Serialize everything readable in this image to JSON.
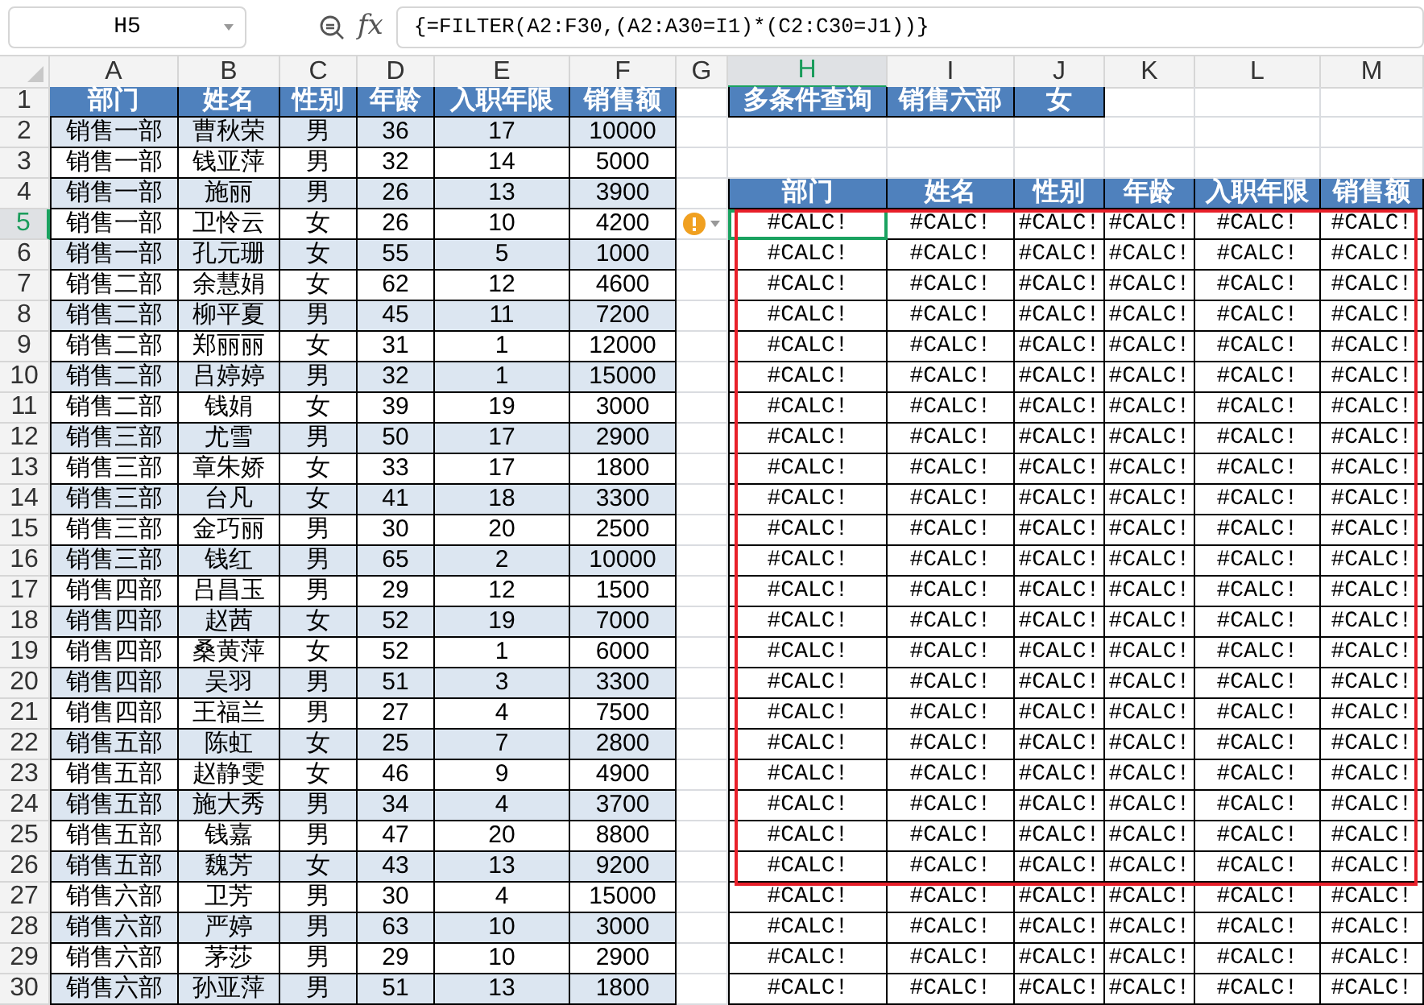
{
  "name_box": {
    "value": "H5"
  },
  "formula_bar": {
    "fx": "fx",
    "formula": "{=FILTER(A2:F30,(A2:A30=I1)*(C2:C30=J1))}"
  },
  "column_headers": [
    {
      "label": "A",
      "selected": false
    },
    {
      "label": "B",
      "selected": false
    },
    {
      "label": "C",
      "selected": false
    },
    {
      "label": "D",
      "selected": false
    },
    {
      "label": "E",
      "selected": false
    },
    {
      "label": "F",
      "selected": false
    },
    {
      "label": "G",
      "selected": false
    },
    {
      "label": "H",
      "selected": true
    },
    {
      "label": "I",
      "selected": false
    },
    {
      "label": "J",
      "selected": false
    },
    {
      "label": "K",
      "selected": false
    },
    {
      "label": "L",
      "selected": false
    },
    {
      "label": "M",
      "selected": false
    }
  ],
  "row_numbers": [
    {
      "label": "1",
      "selected": false
    },
    {
      "label": "2",
      "selected": false
    },
    {
      "label": "3",
      "selected": false
    },
    {
      "label": "4",
      "selected": false
    },
    {
      "label": "5",
      "selected": true
    },
    {
      "label": "6",
      "selected": false
    },
    {
      "label": "7",
      "selected": false
    },
    {
      "label": "8",
      "selected": false
    },
    {
      "label": "9",
      "selected": false
    },
    {
      "label": "10",
      "selected": false
    },
    {
      "label": "11",
      "selected": false
    },
    {
      "label": "12",
      "selected": false
    },
    {
      "label": "13",
      "selected": false
    },
    {
      "label": "14",
      "selected": false
    },
    {
      "label": "15",
      "selected": false
    },
    {
      "label": "16",
      "selected": false
    },
    {
      "label": "17",
      "selected": false
    },
    {
      "label": "18",
      "selected": false
    },
    {
      "label": "19",
      "selected": false
    },
    {
      "label": "20",
      "selected": false
    },
    {
      "label": "21",
      "selected": false
    },
    {
      "label": "22",
      "selected": false
    },
    {
      "label": "23",
      "selected": false
    },
    {
      "label": "24",
      "selected": false
    },
    {
      "label": "25",
      "selected": false
    },
    {
      "label": "26",
      "selected": false
    },
    {
      "label": "27",
      "selected": false
    },
    {
      "label": "28",
      "selected": false
    },
    {
      "label": "29",
      "selected": false
    },
    {
      "label": "30",
      "selected": false
    }
  ],
  "data_table": {
    "columns": [
      "部门",
      "姓名",
      "性别",
      "年龄",
      "入职年限",
      "销售额"
    ],
    "rows": [
      [
        "销售一部",
        "曹秋荣",
        "男",
        "36",
        "17",
        "10000"
      ],
      [
        "销售一部",
        "钱亚萍",
        "男",
        "32",
        "14",
        "5000"
      ],
      [
        "销售一部",
        "施丽",
        "男",
        "26",
        "13",
        "3900"
      ],
      [
        "销售一部",
        "卫怜云",
        "女",
        "26",
        "10",
        "4200"
      ],
      [
        "销售一部",
        "孔元珊",
        "女",
        "55",
        "5",
        "1000"
      ],
      [
        "销售二部",
        "余慧娟",
        "女",
        "62",
        "12",
        "4600"
      ],
      [
        "销售二部",
        "柳平夏",
        "男",
        "45",
        "11",
        "7200"
      ],
      [
        "销售二部",
        "郑丽丽",
        "女",
        "31",
        "1",
        "12000"
      ],
      [
        "销售二部",
        "吕婷婷",
        "男",
        "32",
        "1",
        "15000"
      ],
      [
        "销售二部",
        "钱娟",
        "女",
        "39",
        "19",
        "3000"
      ],
      [
        "销售三部",
        "尤雪",
        "男",
        "50",
        "17",
        "2900"
      ],
      [
        "销售三部",
        "章朱娇",
        "女",
        "33",
        "17",
        "1800"
      ],
      [
        "销售三部",
        "台凡",
        "女",
        "41",
        "18",
        "3300"
      ],
      [
        "销售三部",
        "金巧丽",
        "男",
        "30",
        "20",
        "2500"
      ],
      [
        "销售三部",
        "钱红",
        "男",
        "65",
        "2",
        "10000"
      ],
      [
        "销售四部",
        "吕昌玉",
        "男",
        "29",
        "12",
        "1500"
      ],
      [
        "销售四部",
        "赵茜",
        "女",
        "52",
        "19",
        "7000"
      ],
      [
        "销售四部",
        "桑黄萍",
        "女",
        "52",
        "1",
        "6000"
      ],
      [
        "销售四部",
        "吴羽",
        "男",
        "51",
        "3",
        "3300"
      ],
      [
        "销售四部",
        "王福兰",
        "男",
        "27",
        "4",
        "7500"
      ],
      [
        "销售五部",
        "陈虹",
        "女",
        "25",
        "7",
        "2800"
      ],
      [
        "销售五部",
        "赵静雯",
        "女",
        "46",
        "9",
        "4900"
      ],
      [
        "销售五部",
        "施大秀",
        "男",
        "34",
        "4",
        "3700"
      ],
      [
        "销售五部",
        "钱嘉",
        "男",
        "47",
        "20",
        "8800"
      ],
      [
        "销售五部",
        "魏芳",
        "女",
        "43",
        "13",
        "9200"
      ],
      [
        "销售六部",
        "卫芳",
        "男",
        "30",
        "4",
        "15000"
      ],
      [
        "销售六部",
        "严婷",
        "男",
        "63",
        "10",
        "3000"
      ],
      [
        "销售六部",
        "茅莎",
        "男",
        "29",
        "10",
        "2900"
      ],
      [
        "销售六部",
        "孙亚萍",
        "男",
        "51",
        "13",
        "1800"
      ]
    ]
  },
  "query": [
    "多条件查询",
    "销售六部",
    "女"
  ],
  "result_table": {
    "columns": [
      "部门",
      "姓名",
      "性别",
      "年龄",
      "入职年限",
      "销售额"
    ],
    "rows": [
      {
        "selected": true,
        "warning": true,
        "cells": [
          "#CALC!",
          "#CALC!",
          "#CALC!",
          "#CALC!",
          "#CALC!",
          "#CALC!"
        ]
      },
      {
        "selected": false,
        "warning": false,
        "cells": [
          "#CALC!",
          "#CALC!",
          "#CALC!",
          "#CALC!",
          "#CALC!",
          "#CALC!"
        ]
      },
      {
        "selected": false,
        "warning": false,
        "cells": [
          "#CALC!",
          "#CALC!",
          "#CALC!",
          "#CALC!",
          "#CALC!",
          "#CALC!"
        ]
      },
      {
        "selected": false,
        "warning": false,
        "cells": [
          "#CALC!",
          "#CALC!",
          "#CALC!",
          "#CALC!",
          "#CALC!",
          "#CALC!"
        ]
      },
      {
        "selected": false,
        "warning": false,
        "cells": [
          "#CALC!",
          "#CALC!",
          "#CALC!",
          "#CALC!",
          "#CALC!",
          "#CALC!"
        ]
      },
      {
        "selected": false,
        "warning": false,
        "cells": [
          "#CALC!",
          "#CALC!",
          "#CALC!",
          "#CALC!",
          "#CALC!",
          "#CALC!"
        ]
      },
      {
        "selected": false,
        "warning": false,
        "cells": [
          "#CALC!",
          "#CALC!",
          "#CALC!",
          "#CALC!",
          "#CALC!",
          "#CALC!"
        ]
      },
      {
        "selected": false,
        "warning": false,
        "cells": [
          "#CALC!",
          "#CALC!",
          "#CALC!",
          "#CALC!",
          "#CALC!",
          "#CALC!"
        ]
      },
      {
        "selected": false,
        "warning": false,
        "cells": [
          "#CALC!",
          "#CALC!",
          "#CALC!",
          "#CALC!",
          "#CALC!",
          "#CALC!"
        ]
      },
      {
        "selected": false,
        "warning": false,
        "cells": [
          "#CALC!",
          "#CALC!",
          "#CALC!",
          "#CALC!",
          "#CALC!",
          "#CALC!"
        ]
      },
      {
        "selected": false,
        "warning": false,
        "cells": [
          "#CALC!",
          "#CALC!",
          "#CALC!",
          "#CALC!",
          "#CALC!",
          "#CALC!"
        ]
      },
      {
        "selected": false,
        "warning": false,
        "cells": [
          "#CALC!",
          "#CALC!",
          "#CALC!",
          "#CALC!",
          "#CALC!",
          "#CALC!"
        ]
      },
      {
        "selected": false,
        "warning": false,
        "cells": [
          "#CALC!",
          "#CALC!",
          "#CALC!",
          "#CALC!",
          "#CALC!",
          "#CALC!"
        ]
      },
      {
        "selected": false,
        "warning": false,
        "cells": [
          "#CALC!",
          "#CALC!",
          "#CALC!",
          "#CALC!",
          "#CALC!",
          "#CALC!"
        ]
      },
      {
        "selected": false,
        "warning": false,
        "cells": [
          "#CALC!",
          "#CALC!",
          "#CALC!",
          "#CALC!",
          "#CALC!",
          "#CALC!"
        ]
      },
      {
        "selected": false,
        "warning": false,
        "cells": [
          "#CALC!",
          "#CALC!",
          "#CALC!",
          "#CALC!",
          "#CALC!",
          "#CALC!"
        ]
      },
      {
        "selected": false,
        "warning": false,
        "cells": [
          "#CALC!",
          "#CALC!",
          "#CALC!",
          "#CALC!",
          "#CALC!",
          "#CALC!"
        ]
      },
      {
        "selected": false,
        "warning": false,
        "cells": [
          "#CALC!",
          "#CALC!",
          "#CALC!",
          "#CALC!",
          "#CALC!",
          "#CALC!"
        ]
      },
      {
        "selected": false,
        "warning": false,
        "cells": [
          "#CALC!",
          "#CALC!",
          "#CALC!",
          "#CALC!",
          "#CALC!",
          "#CALC!"
        ]
      },
      {
        "selected": false,
        "warning": false,
        "cells": [
          "#CALC!",
          "#CALC!",
          "#CALC!",
          "#CALC!",
          "#CALC!",
          "#CALC!"
        ]
      },
      {
        "selected": false,
        "warning": false,
        "cells": [
          "#CALC!",
          "#CALC!",
          "#CALC!",
          "#CALC!",
          "#CALC!",
          "#CALC!"
        ]
      },
      {
        "selected": false,
        "warning": false,
        "cells": [
          "#CALC!",
          "#CALC!",
          "#CALC!",
          "#CALC!",
          "#CALC!",
          "#CALC!"
        ]
      },
      {
        "selected": false,
        "warning": false,
        "cells": [
          "#CALC!",
          "#CALC!",
          "#CALC!",
          "#CALC!",
          "#CALC!",
          "#CALC!"
        ]
      },
      {
        "selected": false,
        "warning": false,
        "cells": [
          "#CALC!",
          "#CALC!",
          "#CALC!",
          "#CALC!",
          "#CALC!",
          "#CALC!"
        ]
      },
      {
        "selected": false,
        "warning": false,
        "cells": [
          "#CALC!",
          "#CALC!",
          "#CALC!",
          "#CALC!",
          "#CALC!",
          "#CALC!"
        ]
      },
      {
        "selected": false,
        "warning": false,
        "cells": [
          "#CALC!",
          "#CALC!",
          "#CALC!",
          "#CALC!",
          "#CALC!",
          "#CALC!"
        ]
      }
    ]
  }
}
